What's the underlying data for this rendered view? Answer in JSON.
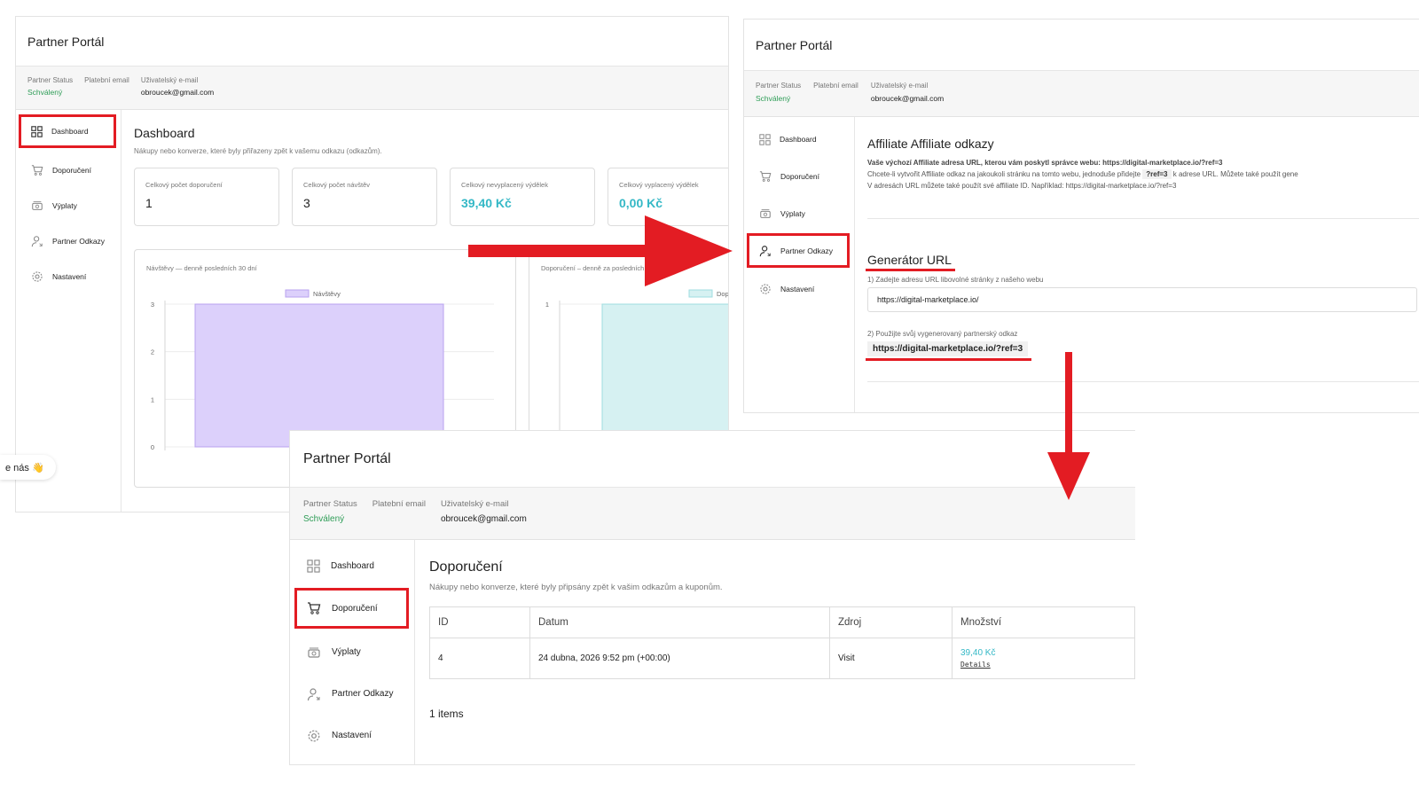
{
  "portal_title": "Partner Portál",
  "status": {
    "partner_status_label": "Partner Status",
    "partner_status_value": "Schválený",
    "billing_email_label": "Platební email",
    "user_email_label": "Uživatelský e-mail",
    "user_email_value": "obroucek@gmail.com"
  },
  "nav": {
    "dashboard": "Dashboard",
    "referrals": "Doporučení",
    "payouts": "Výplaty",
    "partner_links": "Partner Odkazy",
    "settings": "Nastavení"
  },
  "dashboard": {
    "title": "Dashboard",
    "subtitle": "Nákupy nebo konverze, které byly přiřazeny zpět k vašemu odkazu (odkazům).",
    "cards": [
      {
        "label": "Celkový počet doporučení",
        "value": "1"
      },
      {
        "label": "Celkový počet návštěv",
        "value": "3"
      },
      {
        "label": "Celkový nevyplacený výdělek",
        "value": "39,40 Kč"
      },
      {
        "label": "Celkový vyplacený výdělek",
        "value": "0,00 Kč"
      }
    ]
  },
  "chart_data": [
    {
      "type": "bar",
      "title": "Návštěvy — denně posledních 30 dní",
      "series": [
        {
          "name": "Návštěvy",
          "values": [
            3
          ]
        }
      ],
      "y_ticks": [
        "0",
        "1",
        "2",
        "3"
      ],
      "ylim": [
        0,
        3
      ],
      "color": "#dcd0fb",
      "border": "#b8a2ef",
      "legend": "top-center",
      "grid": true
    },
    {
      "type": "bar",
      "title": "Doporučení – denně za posledních",
      "series": [
        {
          "name": "Dopo",
          "values": [
            1
          ]
        }
      ],
      "y_ticks": [
        "1"
      ],
      "ylim": [
        0,
        1
      ],
      "color": "#d6f1f2",
      "border": "#9fdde0",
      "legend": "top-center",
      "grid": true
    }
  ],
  "affiliate": {
    "title": "Affiliate Affiliate odkazy",
    "line1": "Vaše výchozí Affiliate adresa URL, kterou vám poskytl správce webu: https://digital-marketplace.io/?ref=3",
    "line2_before": "Chcete-li vytvořit Affiliate odkaz na jakoukoli stránku na tomto webu, jednoduše přidejte",
    "line2_code": "?ref=3",
    "line2_after": "k adrese URL. Můžete také použít gene",
    "line3": "V adresách URL můžete také použít své affiliate ID. Například: https://digital-marketplace.io/?ref=3",
    "generator_title": "Generátor URL",
    "step1": "1) Zadejte adresu URL libovolné stránky z našeho webu",
    "input_value": "https://digital-marketplace.io/",
    "step2": "2) Použijte svůj vygenerovaný partnerský odkaz",
    "generated_link": "https://digital-marketplace.io/?ref=3"
  },
  "referrals": {
    "title": "Doporučení",
    "subtitle": "Nákupy nebo konverze, které byly připsány zpět k vašim odkazům a kuponům.",
    "columns": [
      "ID",
      "Datum",
      "Zdroj",
      "Množství"
    ],
    "rows": [
      {
        "id": "4",
        "date": "24 dubna, 2026 9:52 pm (+00:00)",
        "source": "Visit",
        "amount": "39,40 Kč",
        "details": "Details"
      }
    ],
    "count_text": "1 items"
  },
  "chat_text": "e nás 👋",
  "accent_red": "#e31c23",
  "accent_teal": "#34b8c6",
  "status_green": "#2e9d57"
}
